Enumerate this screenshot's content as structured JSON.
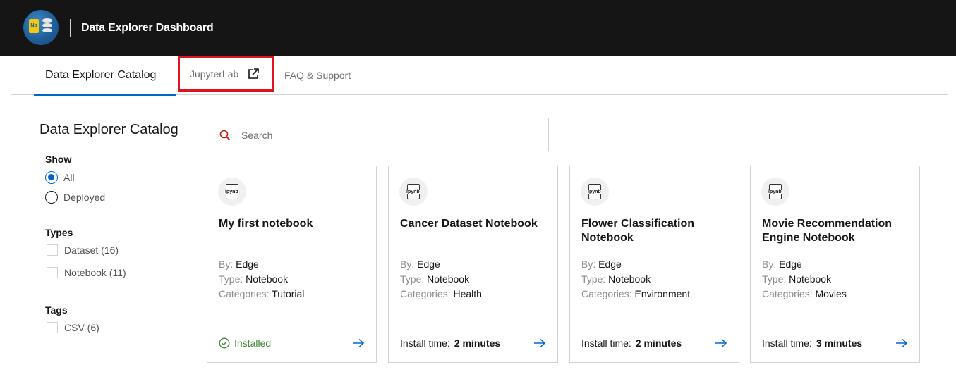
{
  "header": {
    "logo_badge": "Nb",
    "app_title": "Data Explorer Dashboard"
  },
  "tabs": [
    {
      "label": "Data Explorer Catalog"
    },
    {
      "label": "JupyterLab"
    },
    {
      "label": "FAQ & Support"
    }
  ],
  "sidebar": {
    "title": "Data Explorer Catalog",
    "show": {
      "title": "Show",
      "options": [
        "All",
        "Deployed"
      ],
      "selected": "All"
    },
    "types": {
      "title": "Types",
      "options": [
        "Dataset (16)",
        "Notebook (11)"
      ]
    },
    "tags": {
      "title": "Tags",
      "options": [
        "CSV (6)"
      ]
    }
  },
  "search": {
    "placeholder": "Search",
    "value": ""
  },
  "labels": {
    "by": "By:",
    "type": "Type:",
    "categories": "Categories:",
    "install_time": "Install time:"
  },
  "cards": [
    {
      "icon_text": "ipynb",
      "title": "My first notebook",
      "by": "Edge",
      "type": "Notebook",
      "categories": "Tutorial",
      "status": "Installed",
      "install_time": ""
    },
    {
      "icon_text": "ipynb",
      "title": "Cancer Dataset Notebook",
      "by": "Edge",
      "type": "Notebook",
      "categories": "Health",
      "status": "",
      "install_time": "2 minutes"
    },
    {
      "icon_text": "ipynb",
      "title": "Flower Classification Notebook",
      "by": "Edge",
      "type": "Notebook",
      "categories": "Environment",
      "status": "",
      "install_time": "2 minutes"
    },
    {
      "icon_text": "ipynb",
      "title": "Movie Recommendation Engine Notebook",
      "by": "Edge",
      "type": "Notebook",
      "categories": "Movies",
      "status": "",
      "install_time": "3 minutes"
    }
  ],
  "colors": {
    "accent": "#0066cc",
    "highlight_box": "#e0121c",
    "installed": "#3e8635",
    "header_bg": "#151515"
  }
}
